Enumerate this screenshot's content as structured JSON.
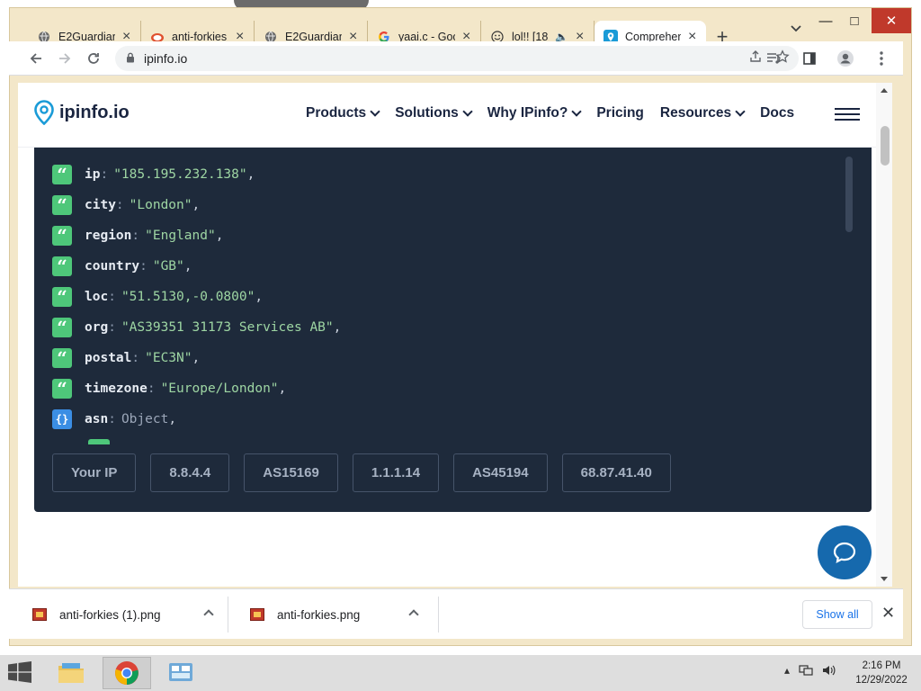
{
  "browser": {
    "tabs": [
      {
        "title": "E2Guardian",
        "favicon": "globe-icon",
        "active": false
      },
      {
        "title": "anti-forkies",
        "favicon": "reddit-icon",
        "active": false
      },
      {
        "title": "E2Guardian",
        "favicon": "globe-icon",
        "active": false
      },
      {
        "title": "yaai.c - Goo",
        "favicon": "google-icon",
        "active": false
      },
      {
        "title": "lol!! [18",
        "favicon": "smiley-icon",
        "active": false
      },
      {
        "title": "Comprehen",
        "favicon": "ipinfo-icon",
        "active": true
      }
    ],
    "address": "ipinfo.io"
  },
  "site": {
    "logo_text": "ipinfo.io",
    "nav": [
      {
        "label": "Products",
        "dropdown": true
      },
      {
        "label": "Solutions",
        "dropdown": true
      },
      {
        "label": "Why IPinfo?",
        "dropdown": true
      },
      {
        "label": "Pricing",
        "dropdown": false
      },
      {
        "label": "Resources",
        "dropdown": true
      },
      {
        "label": "Docs",
        "dropdown": false
      }
    ]
  },
  "json_result": [
    {
      "key": "ip",
      "value": "\"185.195.232.138\"",
      "type": "string"
    },
    {
      "key": "city",
      "value": "\"London\"",
      "type": "string"
    },
    {
      "key": "region",
      "value": "\"England\"",
      "type": "string"
    },
    {
      "key": "country",
      "value": "\"GB\"",
      "type": "string"
    },
    {
      "key": "loc",
      "value": "\"51.5130,-0.0800\"",
      "type": "string"
    },
    {
      "key": "org",
      "value": "\"AS39351 31173 Services AB\"",
      "type": "string"
    },
    {
      "key": "postal",
      "value": "\"EC3N\"",
      "type": "string"
    },
    {
      "key": "timezone",
      "value": "\"Europe/London\"",
      "type": "string"
    },
    {
      "key": "asn",
      "value": "Object",
      "type": "object"
    }
  ],
  "ip_buttons": [
    "Your IP",
    "8.8.4.4",
    "AS15169",
    "1.1.1.14",
    "AS45194",
    "68.87.41.40"
  ],
  "downloads": {
    "items": [
      "anti-forkies (1).png",
      "anti-forkies.png"
    ],
    "show_all": "Show all"
  },
  "taskbar": {
    "time": "2:16 PM",
    "date": "12/29/2022"
  },
  "colors": {
    "json_bg": "#1e2a3b",
    "string_badge": "#4ec77a",
    "object_badge": "#3b8ee4",
    "chat_button": "#1669ad",
    "window_frame": "#f3e7c9"
  }
}
